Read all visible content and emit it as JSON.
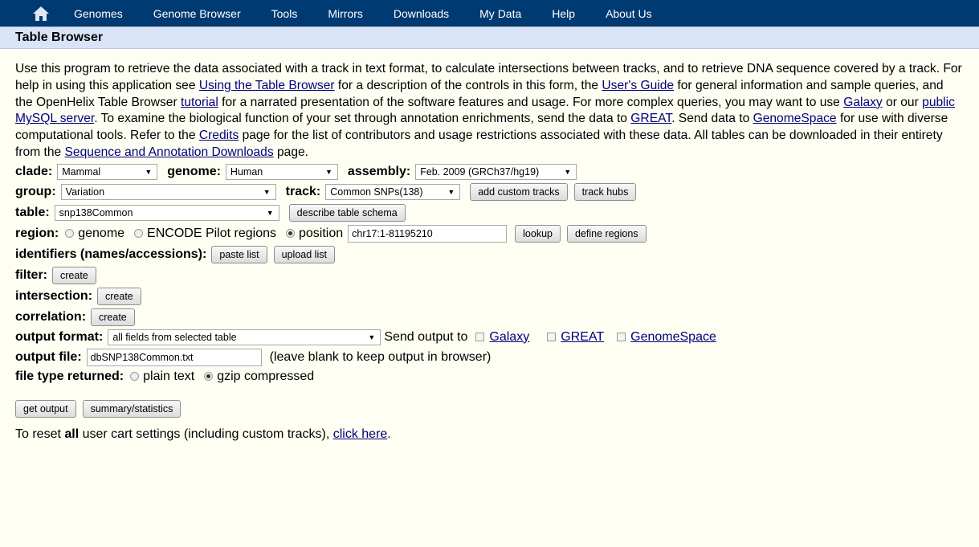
{
  "nav": {
    "items": [
      "Genomes",
      "Genome Browser",
      "Tools",
      "Mirrors",
      "Downloads",
      "My Data",
      "Help",
      "About Us"
    ]
  },
  "header": {
    "title": "Table Browser"
  },
  "intro": {
    "t1": "Use this program to retrieve the data associated with a track in text format, to calculate intersections between tracks, and to retrieve DNA sequence covered by a track. For help in using this application see ",
    "l1": "Using the Table Browser",
    "t2": " for a description of the controls in this form, the ",
    "l2": "User's Guide",
    "t3": " for general information and sample queries, and the OpenHelix Table Browser ",
    "l3": "tutorial",
    "t4": " for a narrated presentation of the software features and usage. For more complex queries, you may want to use ",
    "l4": "Galaxy",
    "t5": " or our ",
    "l5": "public MySQL server",
    "t6": ". To examine the biological function of your set through annotation enrichments, send the data to ",
    "l6": "GREAT",
    "t7": ". Send data to ",
    "l7": "GenomeSpace",
    "t8": " for use with diverse computational tools. Refer to the ",
    "l8": "Credits",
    "t9": " page for the list of contributors and usage restrictions associated with these data. All tables can be downloaded in their entirety from the ",
    "l9": "Sequence and Annotation Downloads",
    "t10": " page."
  },
  "form": {
    "clade_label": "clade:",
    "clade_value": "Mammal",
    "genome_label": "genome:",
    "genome_value": "Human",
    "assembly_label": "assembly:",
    "assembly_value": "Feb. 2009 (GRCh37/hg19)",
    "group_label": "group:",
    "group_value": "Variation",
    "track_label": "track:",
    "track_value": "Common SNPs(138)",
    "add_custom_tracks": "add custom tracks",
    "track_hubs": "track hubs",
    "table_label": "table:",
    "table_value": "snp138Common",
    "describe_schema": "describe table schema",
    "region_label": "region:",
    "region_genome": "genome",
    "region_encode": "ENCODE Pilot regions",
    "region_position": "position",
    "position_value": "chr17:1-81195210",
    "lookup": "lookup",
    "define_regions": "define regions",
    "identifiers_label": "identifiers (names/accessions):",
    "paste_list": "paste list",
    "upload_list": "upload list",
    "filter_label": "filter:",
    "intersection_label": "intersection:",
    "correlation_label": "correlation:",
    "create": "create",
    "output_format_label": "output format:",
    "output_format_value": "all fields from selected table",
    "send_output_to": "Send output to",
    "send_galaxy": "Galaxy",
    "send_great": "GREAT",
    "send_genomespace": "GenomeSpace",
    "output_file_label": "output file:",
    "output_file_value": "dbSNP138Common.txt",
    "output_file_hint": "(leave blank to keep output in browser)",
    "file_type_label": "file type returned:",
    "plain_text": "plain text",
    "gzip": "gzip compressed",
    "get_output": "get output",
    "summary": "summary/statistics"
  },
  "reset": {
    "t1": "To reset ",
    "bold": "all",
    "t2": " user cart settings (including custom tracks), ",
    "link": "click here",
    "t3": "."
  }
}
